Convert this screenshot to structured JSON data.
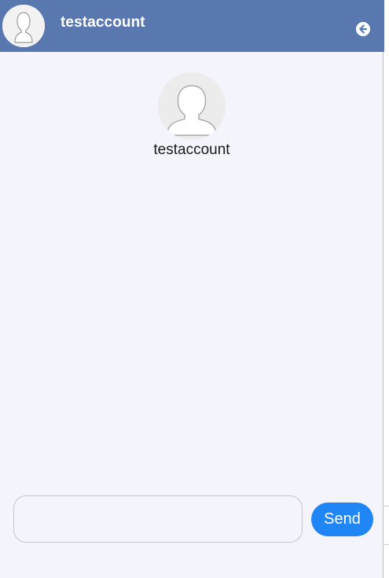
{
  "header": {
    "title": "testaccount",
    "avatar_icon": "user-avatar-icon",
    "back_icon": "arrow-left-circle-icon",
    "background_color": "#5a78b0"
  },
  "profile": {
    "name": "testaccount",
    "avatar_icon": "user-avatar-icon"
  },
  "composer": {
    "message_value": "",
    "placeholder": "",
    "send_label": "Send",
    "send_color": "#2085f5"
  },
  "colors": {
    "chat_background": "#f4f4fc"
  }
}
